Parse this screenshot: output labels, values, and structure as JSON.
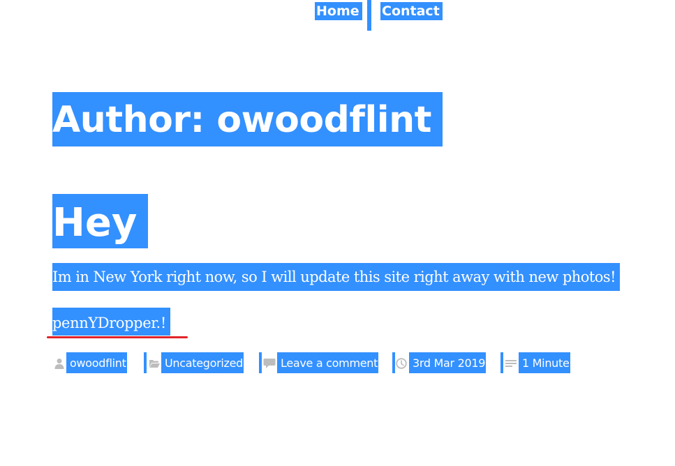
{
  "nav": {
    "items": [
      {
        "label": "Home"
      },
      {
        "label": "Contact"
      }
    ]
  },
  "archive": {
    "title": "Author: owoodflint"
  },
  "post": {
    "title": "Hey",
    "body": "Im in New York right now, so I will update this site right away with new photos!",
    "signature": "pennYDropper.!",
    "meta": {
      "author": "owoodflint",
      "category": "Uncategorized",
      "comments": "Leave a comment",
      "date": "3rd Mar 2019",
      "reading_time": "1 Minute"
    }
  },
  "colors": {
    "selection": "#3390ff",
    "selection_text": "#ffffff",
    "icon": "#bdbdbd",
    "spellcheck": "#e0242a"
  },
  "icons": {
    "author": "user-icon",
    "category": "folder-icon",
    "comments": "comment-icon",
    "date": "clock-icon",
    "reading_time": "lines-icon"
  }
}
